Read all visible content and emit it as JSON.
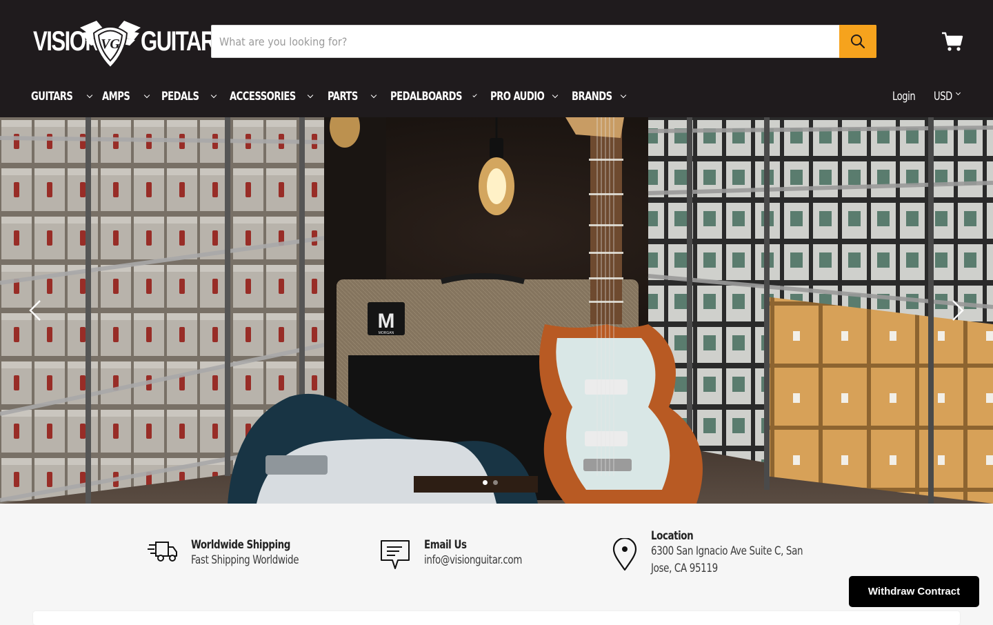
{
  "brand": {
    "logo_word_left": "VISION",
    "logo_word_right": "GUITAR",
    "logo_monogram": "VG"
  },
  "search": {
    "placeholder": "What are you looking for?",
    "icon": "search-icon",
    "button_color": "#f6a31d"
  },
  "cart": {
    "icon": "shopping-cart-icon"
  },
  "nav": {
    "items": [
      {
        "label": "GUITARS"
      },
      {
        "label": "AMPS"
      },
      {
        "label": "PEDALS"
      },
      {
        "label": "ACCESSORIES"
      },
      {
        "label": "PARTS"
      },
      {
        "label": "PEDALBOARDS"
      },
      {
        "label": "PRO AUDIO"
      },
      {
        "label": "BRANDS"
      }
    ],
    "login": "Login",
    "currency": "USD"
  },
  "hero": {
    "amp_badge": "M",
    "amp_brand": "MORGAN",
    "slide_count": 2,
    "active_slide": 1
  },
  "info": {
    "shipping": {
      "title": "Worldwide Shipping",
      "text": "Fast Shipping Worldwide",
      "icon": "delivery-truck-icon"
    },
    "email": {
      "title": "Email Us",
      "text": "info@visionguitar.com",
      "icon": "chat-message-icon"
    },
    "location": {
      "title": "Location",
      "line1": "6300 San Ignacio Ave Suite C, San",
      "line2": "Jose, CA 95119",
      "icon": "map-pin-icon"
    }
  },
  "withdraw_button": "Withdraw Contract",
  "colors": {
    "header_bg": "#1f1b1d",
    "accent": "#f6a31d",
    "page_bg": "#f6f6f6"
  }
}
